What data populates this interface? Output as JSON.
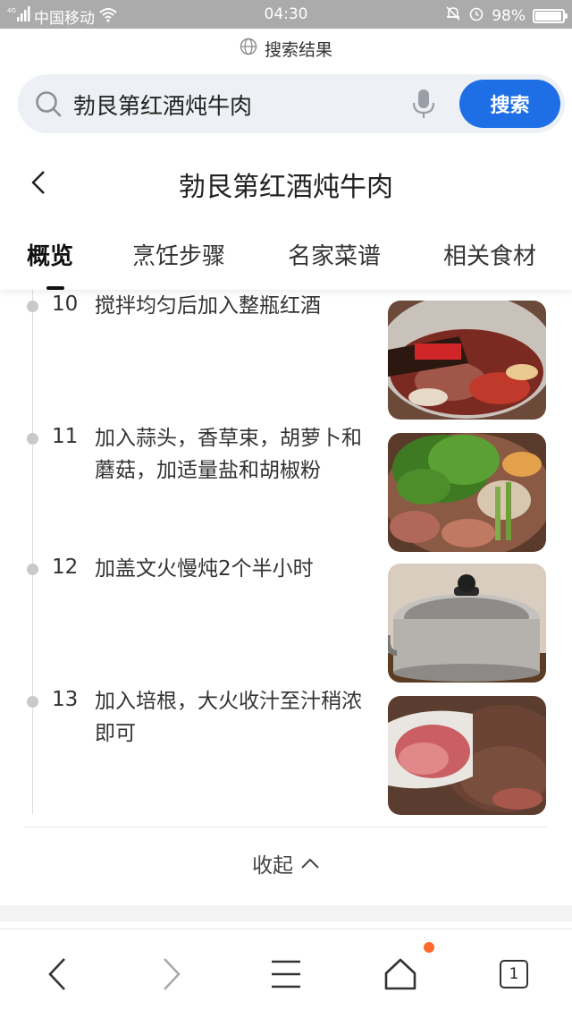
{
  "status_bar": {
    "carrier": "中国移动",
    "time": "04:30",
    "battery": "98%",
    "battery_level": 0.98
  },
  "url_bar": {
    "label": "搜索结果"
  },
  "search": {
    "query": "勃艮第红酒炖牛肉",
    "button_label": "搜索"
  },
  "header": {
    "title": "勃艮第红酒炖牛肉"
  },
  "tabs": [
    {
      "label": "概览",
      "active": true
    },
    {
      "label": "烹饪步骤",
      "active": false
    },
    {
      "label": "名家菜谱",
      "active": false
    },
    {
      "label": "相关食材",
      "active": false
    }
  ],
  "steps": [
    {
      "number": "10",
      "text": "搅拌均匀后加入整瓶红酒"
    },
    {
      "number": "11",
      "text": "加入蒜头，香草束，胡萝卜和蘑菇，加适量盐和胡椒粉"
    },
    {
      "number": "12",
      "text": "加盖文火慢炖2个半小时"
    },
    {
      "number": "13",
      "text": "加入培根，大火收汁至汁稍浓即可"
    }
  ],
  "collapse_label": "收起",
  "bottom_nav": {
    "tab_count": "1"
  },
  "colors": {
    "accent": "#1e6fe6",
    "notification": "#ff6a2c"
  }
}
